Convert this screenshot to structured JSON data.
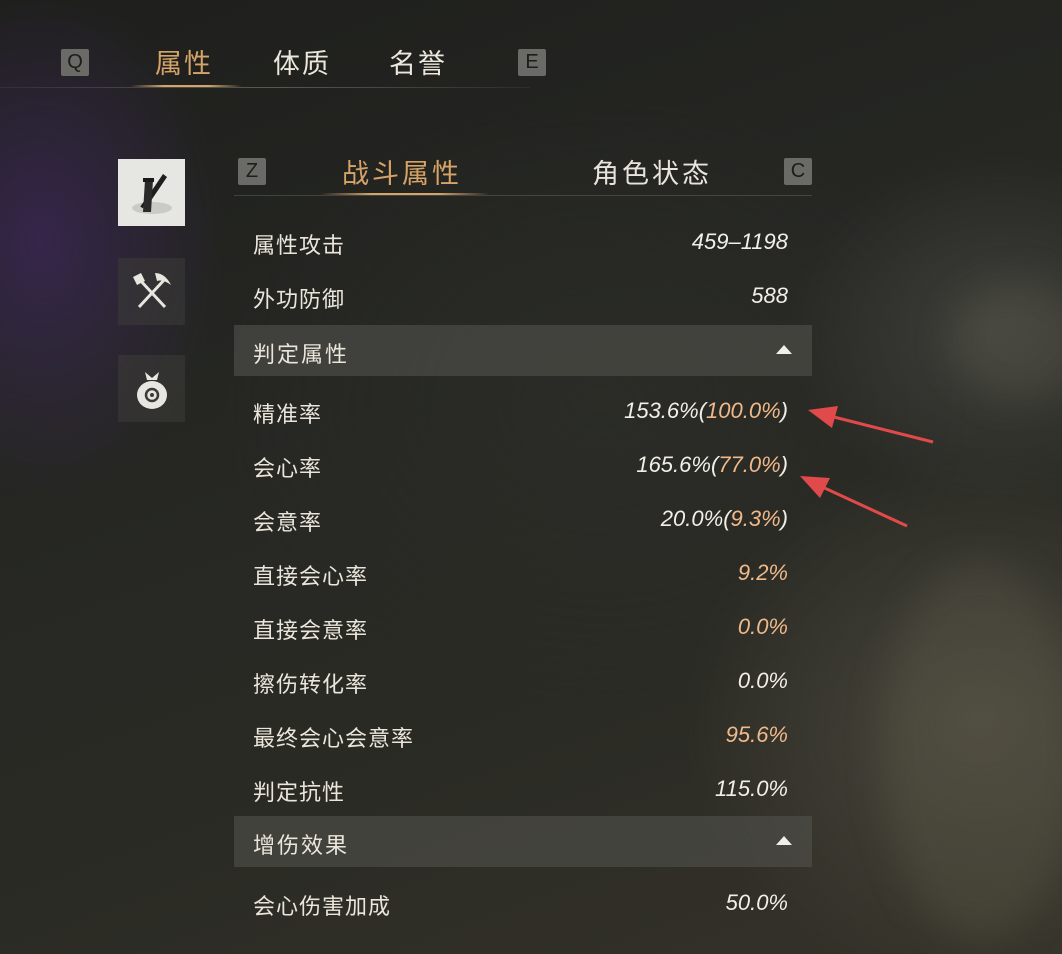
{
  "top_tabs": {
    "prev_key": "Q",
    "next_key": "E",
    "items": [
      {
        "label": "属性",
        "active": true
      },
      {
        "label": "体质",
        "active": false
      },
      {
        "label": "名誉",
        "active": false
      }
    ]
  },
  "side_icons": [
    {
      "icon": "weapon-sword-icon",
      "active": true
    },
    {
      "icon": "tools-shovel-pickaxe-icon",
      "active": false
    },
    {
      "icon": "money-bag-icon",
      "active": false
    }
  ],
  "sub_tabs": {
    "prev_key": "Z",
    "next_key": "C",
    "items": [
      {
        "label": "战斗属性",
        "active": true
      },
      {
        "label": "角色状态",
        "active": false
      }
    ]
  },
  "stats": {
    "attack": {
      "label": "属性攻击",
      "value": "459–1198"
    },
    "defense": {
      "label": "外功防御",
      "value": "588"
    },
    "section_judgement": "判定属性",
    "accuracy": {
      "label": "精准率",
      "value": "153.6%",
      "open": "(",
      "extra": "100.0%",
      "close": ")"
    },
    "crit": {
      "label": "会心率",
      "value": "165.6%",
      "open": "(",
      "extra": "77.0%",
      "close": ")"
    },
    "intent": {
      "label": "会意率",
      "value": "20.0%",
      "open": "(",
      "extra": "9.3%",
      "close": ")"
    },
    "direct_crit": {
      "label": "直接会心率",
      "value": "9.2%"
    },
    "direct_intent": {
      "label": "直接会意率",
      "value": "0.0%"
    },
    "graze_convert": {
      "label": "擦伤转化率",
      "value": "0.0%"
    },
    "final_crit_intent": {
      "label": "最终会心会意率",
      "value": "95.6%"
    },
    "judgement_resist": {
      "label": "判定抗性",
      "value": "115.0%"
    },
    "section_damage": "增伤效果",
    "crit_damage": {
      "label": "会心伤害加成",
      "value": "50.0%"
    }
  },
  "colors": {
    "accent_gold": "#d6a368",
    "highlight_peach": "#f0b98a",
    "annotation_red": "#e04a4a"
  }
}
